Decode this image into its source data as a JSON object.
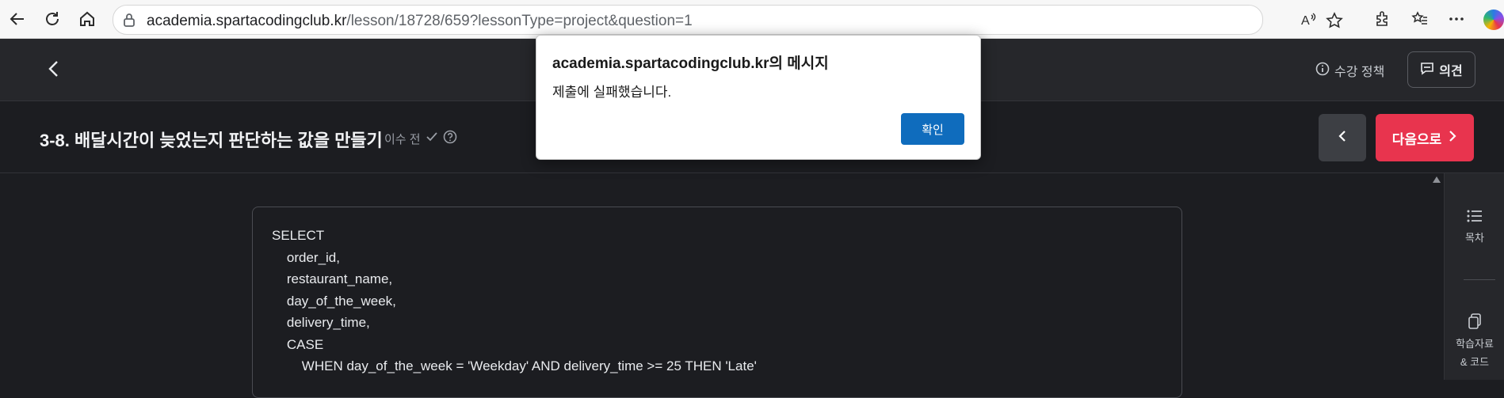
{
  "browser": {
    "url_domain": "academia.spartacodingclub.kr",
    "url_path": "/lesson/18728/659?lessonType=project&question=1"
  },
  "header": {
    "policy_label": "수강 정책",
    "feedback_label": "의견"
  },
  "lesson": {
    "title": "3-8. 배달시간이 늦었는지 판단하는 값을 만들기",
    "status": "이수 전",
    "next_label": "다음으로"
  },
  "code": {
    "lines": [
      "SELECT",
      "    order_id,",
      "    restaurant_name,",
      "    day_of_the_week,",
      "    delivery_time,",
      "    CASE",
      "        WHEN day_of_the_week = 'Weekday' AND delivery_time >= 25 THEN 'Late'"
    ]
  },
  "side_panel": {
    "toc_label": "목차",
    "materials_label_1": "학습자료",
    "materials_label_2": "& 코드"
  },
  "dialog": {
    "title": "academia.spartacodingclub.kr의 메시지",
    "message": "제출에 실패했습니다.",
    "ok_label": "확인"
  },
  "colors": {
    "accent_next": "#e8344e",
    "dialog_button": "#0f6cbd"
  }
}
